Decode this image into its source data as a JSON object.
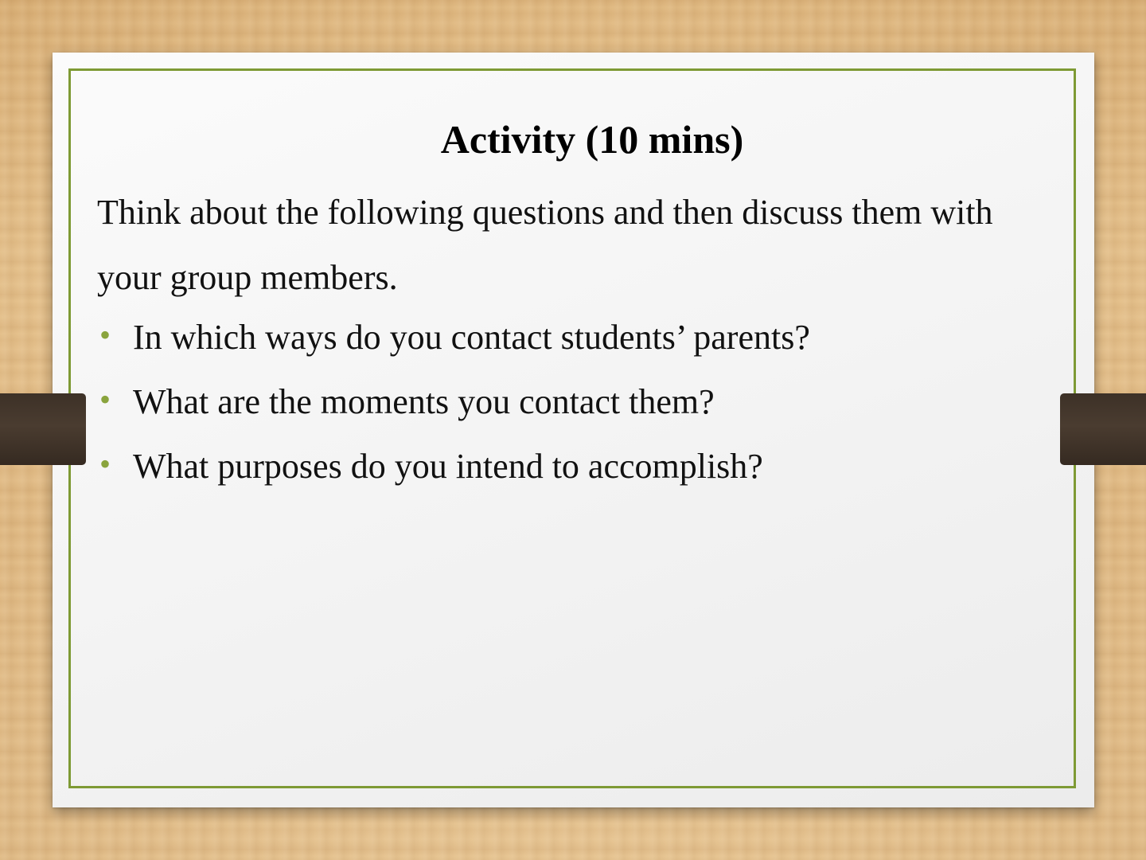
{
  "slide": {
    "title": "Activity (10 mins)",
    "intro_line1": "Think about the following questions and then discuss them with",
    "intro_line2": "your group members.",
    "bullets": [
      "In which ways do you contact students’ parents?",
      "What are the moments you contact them?",
      "What purposes do you intend to accomplish?"
    ]
  },
  "colors": {
    "frame_border": "#7e9a34",
    "bullet": "#8aa43d",
    "strap": "#3d3127",
    "wood": "#ecc993"
  }
}
